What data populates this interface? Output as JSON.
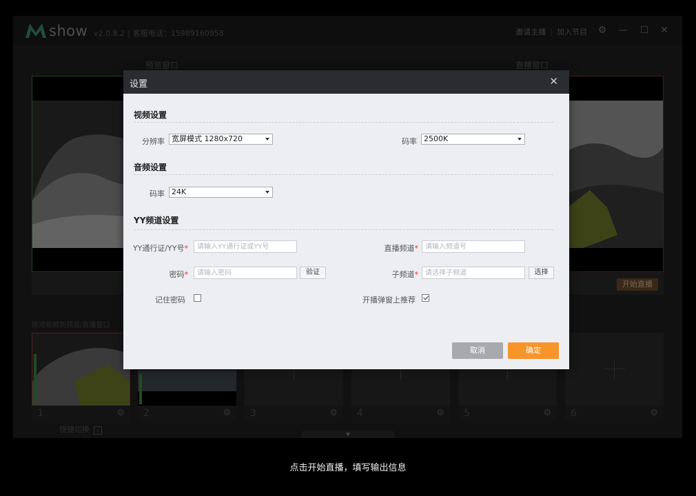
{
  "app": {
    "brand": "show",
    "version": "v2.0.8.2",
    "separator": "|",
    "service_phone": "客服电话：15989160958",
    "invite_host": "邀请主播",
    "join_show": "加入节目",
    "preview_label": "预览窗口",
    "live_label": "直播窗口",
    "go_live": "开始直播",
    "drag_hint": "拖动视频到预览/直播窗口",
    "quick_switch": "快捷切换",
    "slots": [
      "1",
      "2",
      "3",
      "4",
      "5",
      "6"
    ]
  },
  "dialog": {
    "title": "设置",
    "video": {
      "heading": "视频设置",
      "resolution_label": "分辨率",
      "resolution_value": "宽屏模式 1280x720",
      "bitrate_label": "码率",
      "bitrate_value": "2500K"
    },
    "audio": {
      "heading": "音频设置",
      "bitrate_label": "码率",
      "bitrate_value": "24K"
    },
    "yy": {
      "heading": "YY频道设置",
      "pass_label": "YY通行证/YY号",
      "pass_placeholder": "请输入YY通行证或YY号",
      "channel_label": "直播频道",
      "channel_placeholder": "请输入频道号",
      "password_label": "密码",
      "password_placeholder": "请输入密码",
      "verify_button": "验证",
      "subchannel_label": "子频道",
      "subchannel_placeholder": "请选择子频道",
      "select_button": "选择",
      "remember_label": "记住密码",
      "remember_checked": false,
      "popup_label": "开播弹窗上推荐",
      "popup_checked": true
    },
    "cancel": "取消",
    "ok": "确定",
    "required_mark": "*"
  },
  "caption": "点击开始直播，填写输出信息",
  "colors": {
    "accent": "#f7952b",
    "cancel": "#a7a9ac",
    "preview_border": "#3e7a44",
    "live_border": "#7a3a36"
  }
}
